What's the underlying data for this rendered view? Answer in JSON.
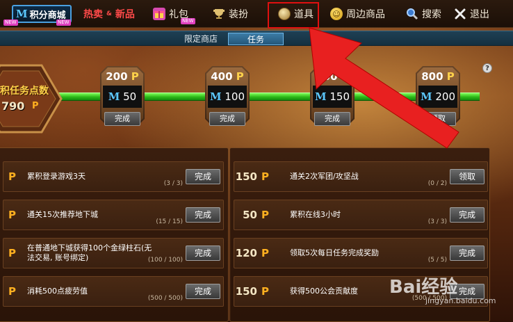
{
  "nav": {
    "points_mall": "积分商城",
    "points_mall_m": "M",
    "hot_new_left": "热卖",
    "hot_new_amp": "&",
    "hot_new_right": "新品",
    "gift": "礼包",
    "dress": "装扮",
    "items": "道具",
    "merch": "周边商品",
    "search": "搜索",
    "exit": "退出"
  },
  "subtabs": {
    "limited_store": "限定商店",
    "task": "任务"
  },
  "progress": {
    "label": "积任务点数",
    "value": "790",
    "unit": "P",
    "milestones": [
      {
        "points": "200",
        "unit": "P",
        "reward": "50",
        "reward_m": "M",
        "button": "完成"
      },
      {
        "points": "400",
        "unit": "P",
        "reward": "100",
        "reward_m": "M",
        "button": "完成"
      },
      {
        "points": "600",
        "unit": "P",
        "reward": "150",
        "reward_m": "M",
        "button": "完成"
      },
      {
        "points": "800",
        "unit": "P",
        "reward": "200",
        "reward_m": "M",
        "button": "领取"
      }
    ]
  },
  "help": "?",
  "tasks_left": [
    {
      "points": "",
      "unit": "P",
      "desc": "累积登录游戏3天",
      "count": "(3 / 3)",
      "button": "完成"
    },
    {
      "points": "",
      "unit": "P",
      "desc": "通关15次推荐地下城",
      "count": "(15 / 15)",
      "button": "完成"
    },
    {
      "points": "",
      "unit": "P",
      "desc": "在普通地下城获得100个金绿柱石(无法交易, 账号绑定)",
      "count": "(100 / 100)",
      "button": "完成"
    },
    {
      "points": "",
      "unit": "P",
      "desc": "消耗500点疲劳值",
      "count": "(500 / 500)",
      "button": "完成"
    }
  ],
  "tasks_right": [
    {
      "points": "150",
      "unit": "P",
      "desc": "通关2次军团/攻坚战",
      "count": "(0 / 2)",
      "button": "领取"
    },
    {
      "points": "50",
      "unit": "P",
      "desc": "累积在线3小时",
      "count": "(3 / 3)",
      "button": "完成"
    },
    {
      "points": "120",
      "unit": "P",
      "desc": "领取5次每日任务完成奖励",
      "count": "(5 / 5)",
      "button": "完成"
    },
    {
      "points": "150",
      "unit": "P",
      "desc": "获得500公会贡献度",
      "count": "(500 / 500)",
      "button": "完成"
    }
  ],
  "watermark": {
    "logo": "Bai经验",
    "sub": "jingyan.baidu.com"
  },
  "colors": {
    "highlight": "#e01010",
    "progress_green": "#2bb818",
    "accent_blue": "#5cc8ff",
    "points_gold": "#ffb020"
  }
}
